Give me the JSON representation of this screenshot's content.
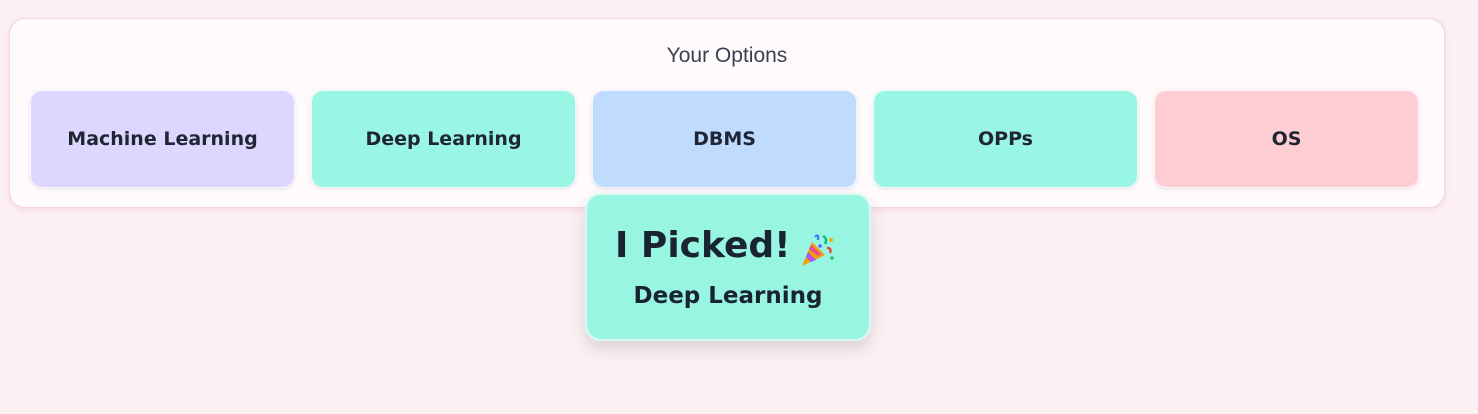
{
  "panel": {
    "title": "Your Options",
    "options": [
      {
        "label": "Machine Learning",
        "color": "#ddd6fe"
      },
      {
        "label": "Deep Learning",
        "color": "#99f6e4"
      },
      {
        "label": "DBMS",
        "color": "#bfdbfe"
      },
      {
        "label": "OPPs",
        "color": "#99f6e4"
      },
      {
        "label": "OS",
        "color": "#fecdd3"
      }
    ]
  },
  "result": {
    "title": "I Picked!",
    "icon": "party-popper-icon",
    "value": "Deep Learning",
    "color": "#98f5e1"
  }
}
